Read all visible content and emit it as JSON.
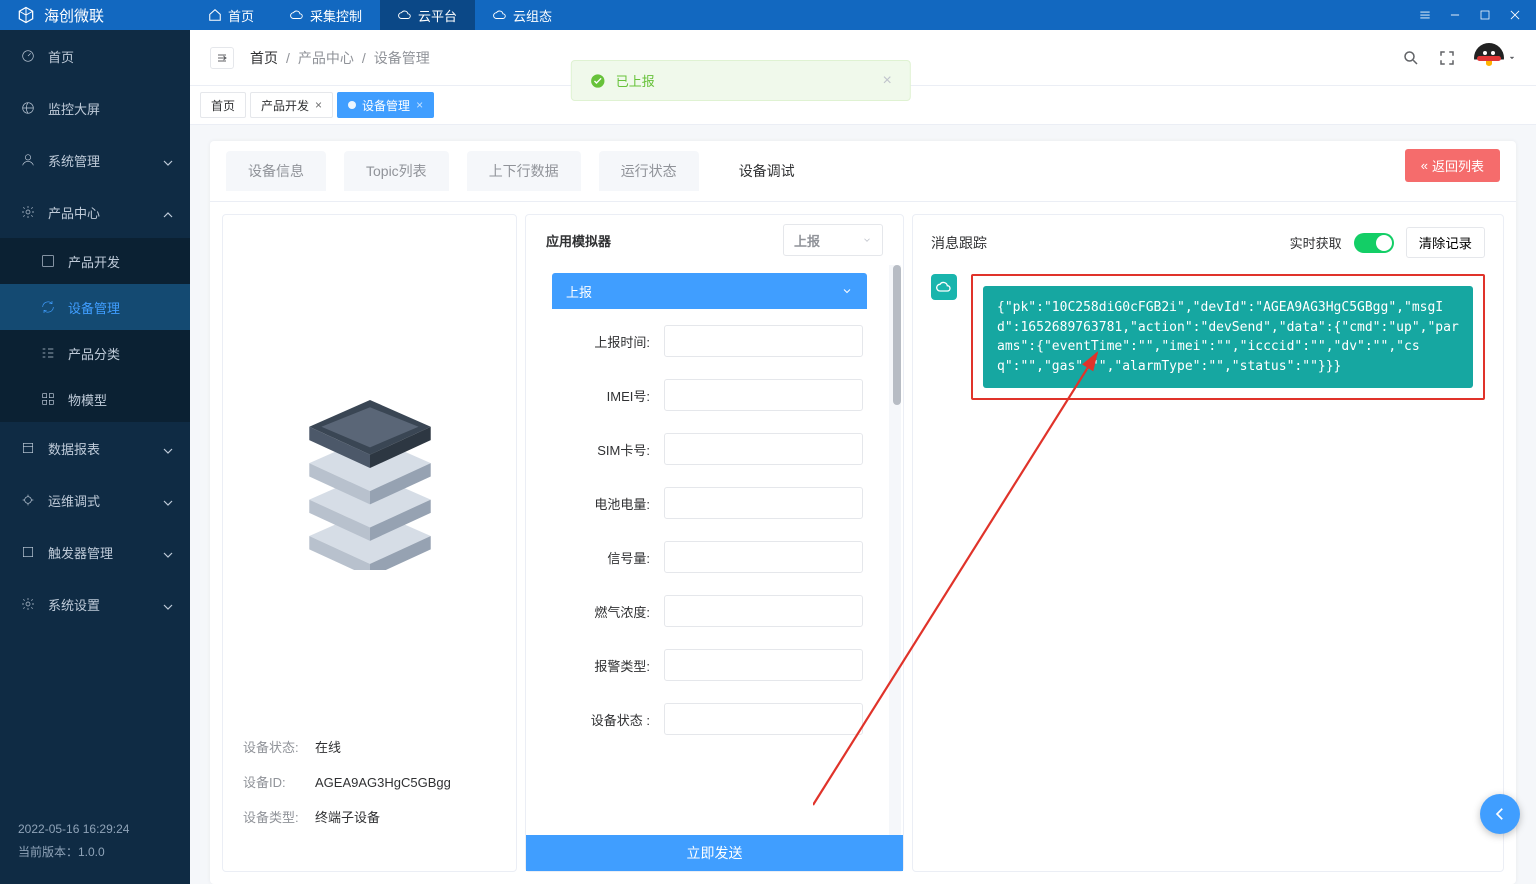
{
  "brand": "海创微联",
  "topnav": [
    {
      "label": "首页",
      "icon": "home"
    },
    {
      "label": "采集控制",
      "icon": "cloud-upload"
    },
    {
      "label": "云平台",
      "icon": "cloud",
      "active": true
    },
    {
      "label": "云组态",
      "icon": "layout"
    }
  ],
  "sidebar": {
    "items": [
      {
        "label": "首页",
        "icon": "dash"
      },
      {
        "label": "监控大屏",
        "icon": "globe"
      },
      {
        "label": "系统管理",
        "icon": "user",
        "expandable": true,
        "open": false
      },
      {
        "label": "产品中心",
        "icon": "gear",
        "expandable": true,
        "open": true,
        "children": [
          {
            "label": "产品开发",
            "icon": "code"
          },
          {
            "label": "设备管理",
            "icon": "loop",
            "active": true
          },
          {
            "label": "产品分类",
            "icon": "list"
          },
          {
            "label": "物模型",
            "icon": "grid"
          }
        ]
      },
      {
        "label": "数据报表",
        "icon": "report",
        "expandable": true,
        "open": false
      },
      {
        "label": "运维调式",
        "icon": "bug",
        "expandable": true,
        "open": false
      },
      {
        "label": "触发器管理",
        "icon": "trigger",
        "expandable": true,
        "open": false
      },
      {
        "label": "系统设置",
        "icon": "gear",
        "expandable": true,
        "open": false
      }
    ],
    "footer": {
      "time": "2022-05-16 16:29:24",
      "version": "当前版本：1.0.0"
    }
  },
  "breadcrumbs": {
    "first": "首页",
    "rest": [
      "产品中心",
      "设备管理"
    ]
  },
  "mini_tabs": [
    {
      "label": "首页"
    },
    {
      "label": "产品开发",
      "closable": true
    },
    {
      "label": "设备管理",
      "closable": true,
      "active": true
    }
  ],
  "toast": {
    "text": "已上报"
  },
  "page_tabs": [
    {
      "label": "设备信息"
    },
    {
      "label": "Topic列表"
    },
    {
      "label": "上下行数据"
    },
    {
      "label": "运行状态"
    },
    {
      "label": "设备调试",
      "active": true
    }
  ],
  "back_button": "返回列表",
  "device": {
    "status_label": "设备状态:",
    "status": "在线",
    "id_label": "设备ID:",
    "id": "AGEA9AG3HgC5GBgg",
    "type_label": "设备类型:",
    "type": "终端子设备"
  },
  "simulator": {
    "title": "应用模拟器",
    "action_select": "上报",
    "accordion": "上报",
    "fields": [
      {
        "label": "上报时间:"
      },
      {
        "label": "IMEI号:"
      },
      {
        "label": "SIM卡号:"
      },
      {
        "label": "电池电量:"
      },
      {
        "label": "信号量:"
      },
      {
        "label": "燃气浓度:"
      },
      {
        "label": "报警类型:"
      },
      {
        "label": "设备状态 :"
      }
    ],
    "send": "立即发送"
  },
  "log": {
    "title": "消息跟踪",
    "realtime_label": "实时获取",
    "clear_label": "清除记录",
    "message": "{\"pk\":\"10C258diG0cFGB2i\",\"devId\":\"AGEA9AG3HgC5GBgg\",\"msgId\":1652689763781,\"action\":\"devSend\",\"data\":{\"cmd\":\"up\",\"params\":{\"eventTime\":\"\",\"imei\":\"\",\"icccid\":\"\",\"dv\":\"\",\"csq\":\"\",\"gas\":\"\",\"alarmType\":\"\",\"status\":\"\"}}}"
  }
}
